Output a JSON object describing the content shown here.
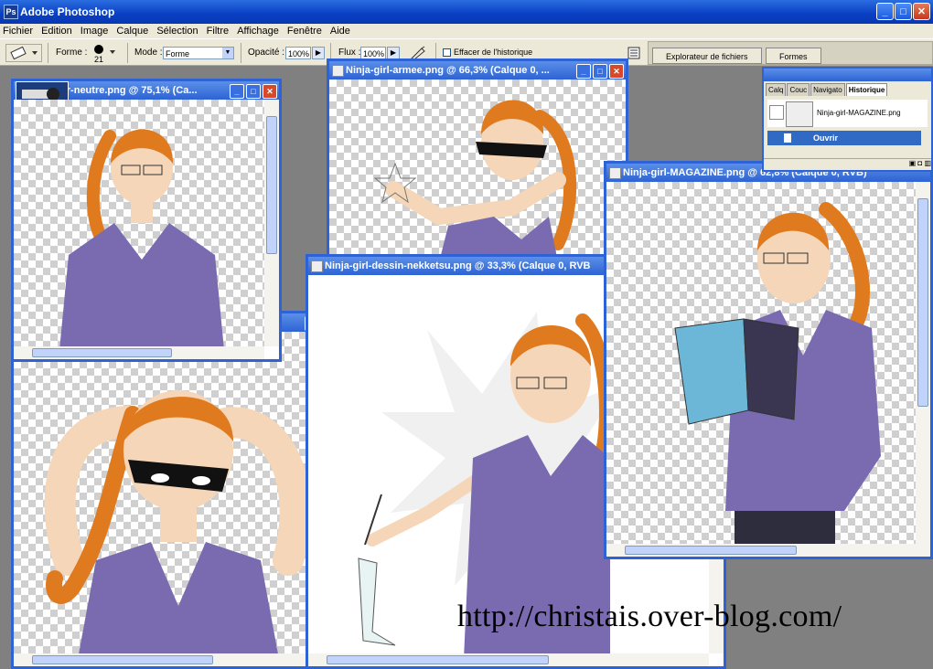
{
  "app": {
    "title": "Adobe Photoshop",
    "icon_glyph": "Ps"
  },
  "window_buttons": {
    "minimize": "_",
    "maximize": "□",
    "close": "✕"
  },
  "menu": [
    "Fichier",
    "Edition",
    "Image",
    "Calque",
    "Sélection",
    "Filtre",
    "Affichage",
    "Fenêtre",
    "Aide"
  ],
  "options_bar": {
    "forme_label": "Forme :",
    "brush_size": "21",
    "mode_label": "Mode :",
    "mode_value": "Forme",
    "opacite_label": "Opacité :",
    "opacite_value": "100%",
    "flux_label": "Flux :",
    "flux_value": "100%",
    "effacer_label": "Effacer de l'historique",
    "tab_explorateur": "Explorateur de fichiers",
    "tab_formes": "Formes"
  },
  "documents": {
    "neutre": {
      "title": "gir-neutre.png @ 75,1% (Ca..."
    },
    "armee": {
      "title": "Ninja-girl-armee.png @ 66,3% (Calque 0, ..."
    },
    "dessin": {
      "title": "Ninja-girl-dessin-nekketsu.png @ 33,3% (Calque 0, RVB"
    },
    "magazine": {
      "title": "Ninja-girl-MAGAZINE.png @ 62,8% (Calque 0, RVB)"
    }
  },
  "history_panel": {
    "tabs": [
      "Calq",
      "Couc",
      "Navigato",
      "Historique"
    ],
    "snapshot_name": "Ninja-girl-MAGAZINE.png",
    "step": "Ouvrir"
  },
  "colors": {
    "xp_blue": "#2d63d4",
    "hair": "#e07a1e",
    "sweater": "#7a6bb0",
    "skin": "#f6d6b8"
  },
  "watermark": "http://christais.over-blog.com/"
}
